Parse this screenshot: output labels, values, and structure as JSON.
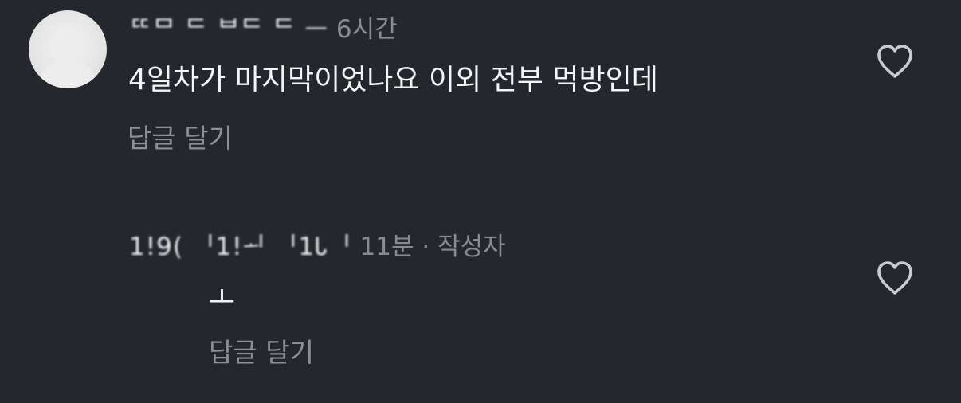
{
  "comments": [
    {
      "username": "ᄄᄆ ᄃ ᄇᄃ ᄃ ᅳ",
      "time": "6시간",
      "text": "4일차가 마지막이었나요 이외 전부 먹방인데",
      "reply_label": "답글 달기",
      "like_icon": "heart-outline-icon"
    },
    {
      "username": "1!9( ᅵ1!ᅬ ᅵ1Ꮣᅵ",
      "time": "11분",
      "separator": "·",
      "author_badge": "작성자",
      "text": "ㅗ",
      "reply_label": "답글 달기",
      "like_icon": "heart-outline-icon"
    }
  ],
  "colors": {
    "background": "#24272e",
    "primary_text": "#f4f4f4",
    "secondary_text": "#878b93"
  }
}
